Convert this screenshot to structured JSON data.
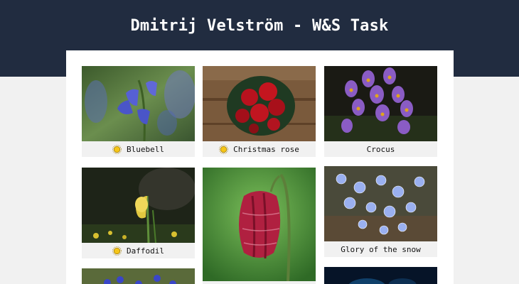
{
  "header": {
    "title": "Dmitrij Velström - W&S Task"
  },
  "colors": {
    "header_bg": "#212c40",
    "page_bg": "#f1f1f1",
    "card_caption_bg": "#f1f1f1",
    "sun": "#f5c518"
  },
  "gallery": {
    "items": [
      {
        "name": "Bluebell",
        "icon": "sun-icon"
      },
      {
        "name": "Christmas rose",
        "icon": "sun-icon"
      },
      {
        "name": "Crocus",
        "icon": ""
      },
      {
        "name": "Daffodil",
        "icon": "sun-icon"
      },
      {
        "name": "",
        "icon": ""
      },
      {
        "name": "Glory of the snow",
        "icon": ""
      }
    ]
  }
}
